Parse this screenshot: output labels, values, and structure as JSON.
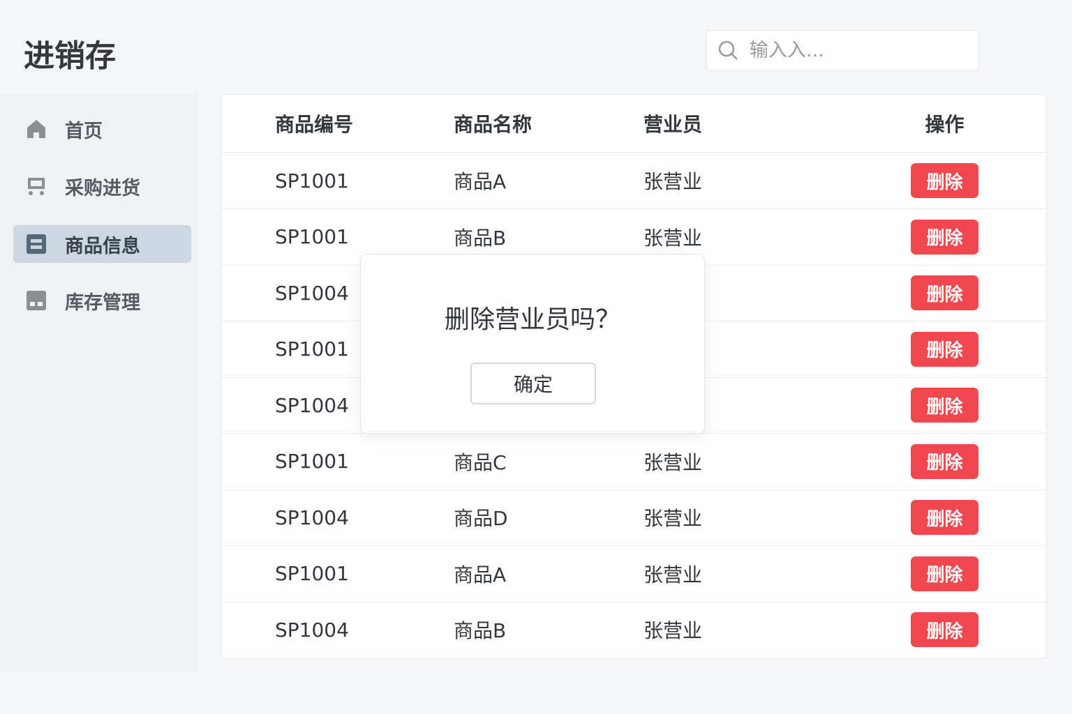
{
  "app_title": "进销存",
  "search": {
    "placeholder": "输入入..."
  },
  "sidebar": {
    "items": [
      {
        "label": "首页"
      },
      {
        "label": "采购进货"
      },
      {
        "label": "商品信息"
      },
      {
        "label": "库存管理"
      }
    ]
  },
  "table": {
    "headers": [
      "商品编号",
      "商品名称",
      "营业员",
      "操作"
    ],
    "rows": [
      {
        "id": "SP1001",
        "name": "商品A",
        "staff": "张营业",
        "action": "删除"
      },
      {
        "id": "SP1001",
        "name": "商品B",
        "staff": "张营业",
        "action": "删除"
      },
      {
        "id": "SP1004",
        "name": "",
        "staff": "",
        "action": "删除"
      },
      {
        "id": "SP1001",
        "name": "",
        "staff": "",
        "action": "删除"
      },
      {
        "id": "SP1004",
        "name": "",
        "staff": "",
        "action": "删除"
      },
      {
        "id": "SP1001",
        "name": "商品C",
        "staff": "张营业",
        "action": "删除"
      },
      {
        "id": "SP1004",
        "name": "商品D",
        "staff": "张营业",
        "action": "删除"
      },
      {
        "id": "SP1001",
        "name": "商品A",
        "staff": "张营业",
        "action": "删除"
      },
      {
        "id": "SP1004",
        "name": "商品B",
        "staff": "张营业",
        "action": "删除"
      }
    ]
  },
  "modal": {
    "question": "删除营业员吗？",
    "confirm": "确定"
  }
}
